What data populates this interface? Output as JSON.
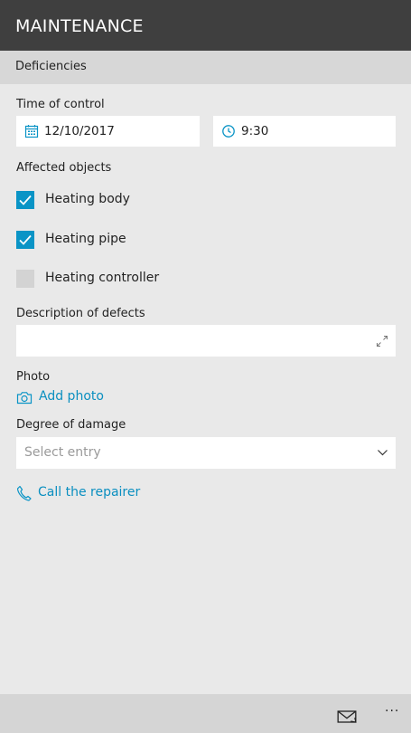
{
  "app": {
    "title": "MAINTENANCE"
  },
  "section": {
    "label": "Deficiencies"
  },
  "time_of_control": {
    "label": "Time of control",
    "date": "12/10/2017",
    "time": "9:30"
  },
  "affected_objects": {
    "label": "Affected objects",
    "items": [
      {
        "label": "Heating body",
        "checked": true
      },
      {
        "label": "Heating pipe",
        "checked": true
      },
      {
        "label": "Heating controller",
        "checked": false
      }
    ]
  },
  "description": {
    "label": "Description of defects",
    "value": ""
  },
  "photo": {
    "label": "Photo",
    "add_label": "Add photo"
  },
  "damage": {
    "label": "Degree of damage",
    "placeholder": "Select entry"
  },
  "call": {
    "label": "Call the repairer"
  },
  "colors": {
    "accent": "#0a94c6",
    "titlebar": "#3f3f3f",
    "background": "#e9e9e9"
  },
  "icons": [
    "calendar-icon",
    "clock-icon",
    "check-icon",
    "expand-icon",
    "camera-icon",
    "chevron-down-icon",
    "phone-icon",
    "mail-icon",
    "more-icon"
  ],
  "bottombar": {
    "more_label": "···"
  }
}
